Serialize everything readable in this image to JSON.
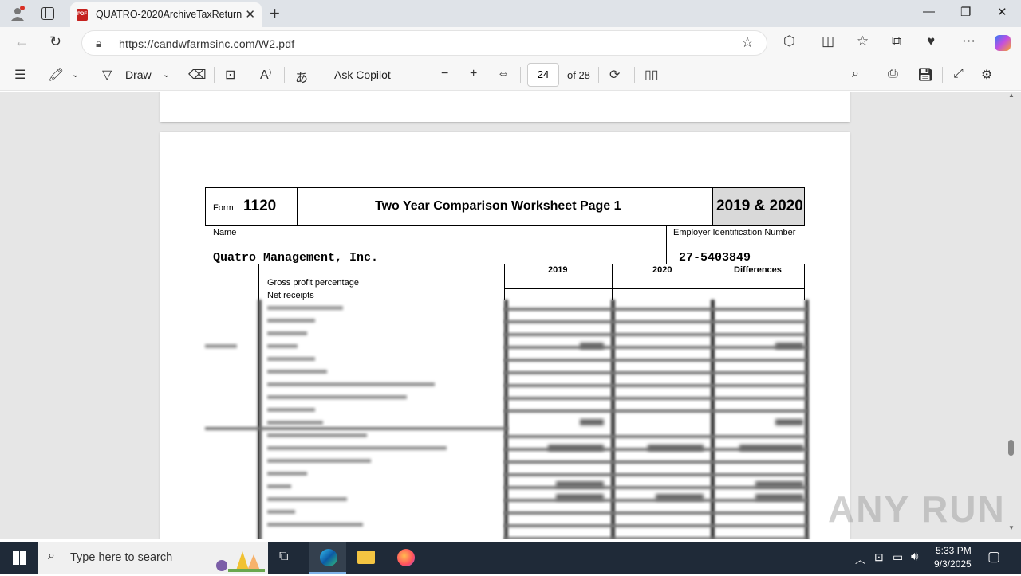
{
  "browser": {
    "tab_title": "QUATRO-2020ArchiveTaxReturn",
    "tab_icon_text": "PDF",
    "url": "https://candwfarmsinc.com/W2.pdf"
  },
  "pdf_toolbar": {
    "draw_label": "Draw",
    "copilot_label": "Ask Copilot",
    "current_page": "24",
    "total_pages": "of 28"
  },
  "form": {
    "form_label": "Form",
    "form_number": "1120",
    "title": "Two Year Comparison Worksheet Page 1",
    "years": "2019 & 2020",
    "name_label": "Name",
    "ein_label": "Employer Identification Number",
    "company_name": "Quatro Management, Inc.",
    "ein": "27-5403849",
    "columns": [
      "2019",
      "2020",
      "Differences"
    ],
    "rows": [
      "Gross profit percentage",
      "Net receipts"
    ]
  },
  "watermark": "ANY RUN",
  "taskbar": {
    "search_placeholder": "Type here to search",
    "time": "5:33 PM",
    "date": "9/3/2025"
  }
}
